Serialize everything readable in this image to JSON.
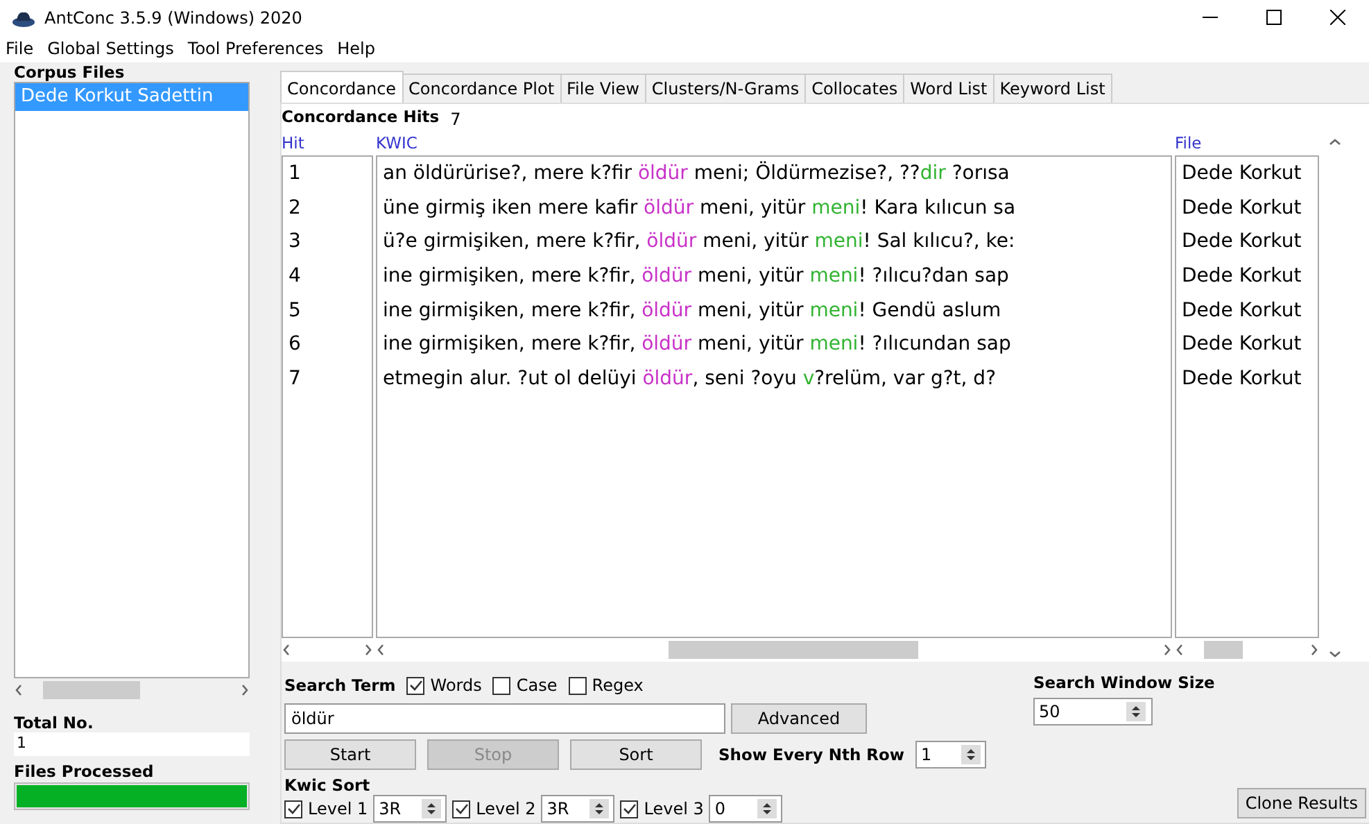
{
  "window": {
    "title": "AntConc 3.5.9 (Windows) 2020"
  },
  "menu": [
    "File",
    "Global Settings",
    "Tool Preferences",
    "Help"
  ],
  "corpus_files": {
    "title": "Corpus Files",
    "items": [
      {
        "label": "Dede Korkut Sadettin",
        "selected": true
      }
    ]
  },
  "total_no": {
    "label": "Total No.",
    "value": "1"
  },
  "files_processed": {
    "label": "Files Processed",
    "level": 1
  },
  "tabs": [
    {
      "label": "Concordance",
      "selected": true
    },
    {
      "label": "Concordance Plot",
      "selected": false
    },
    {
      "label": "File View",
      "selected": false
    },
    {
      "label": "Clusters/N-Grams",
      "selected": false
    },
    {
      "label": "Collocates",
      "selected": false
    },
    {
      "label": "Word List",
      "selected": false
    },
    {
      "label": "Keyword List",
      "selected": false
    }
  ],
  "hits": {
    "label": "Concordance Hits",
    "value": "7"
  },
  "table": {
    "columns": [
      "Hit",
      "KWIC",
      "File"
    ],
    "rows": [
      {
        "hit": "1",
        "kwic": [
          {
            "kind": "plain",
            "text": "an öldürürise?, mere k?fir "
          },
          {
            "kind": "node",
            "text": "öldür"
          },
          {
            "kind": "plain",
            "text": " meni; Öldürmezise?, ??"
          },
          {
            "kind": "collocate",
            "text": "dir"
          },
          {
            "kind": "plain",
            "text": " ?orısa"
          }
        ],
        "file": "Dede Korkut"
      },
      {
        "hit": "2",
        "kwic": [
          {
            "kind": "plain",
            "text": "üne girmiş iken mere kafir "
          },
          {
            "kind": "node",
            "text": "öldür"
          },
          {
            "kind": "plain",
            "text": " meni, yitür "
          },
          {
            "kind": "collocate",
            "text": "meni"
          },
          {
            "kind": "plain",
            "text": "! Kara kılıcun sa"
          }
        ],
        "file": "Dede Korkut"
      },
      {
        "hit": "3",
        "kwic": [
          {
            "kind": "plain",
            "text": "ü?e girmişiken, mere k?fir, "
          },
          {
            "kind": "node",
            "text": "öldür"
          },
          {
            "kind": "plain",
            "text": " meni, yitür "
          },
          {
            "kind": "collocate",
            "text": "meni"
          },
          {
            "kind": "plain",
            "text": "!  Sal kılıcu?, ke:"
          }
        ],
        "file": "Dede Korkut"
      },
      {
        "hit": "4",
        "kwic": [
          {
            "kind": "plain",
            "text": "ine girmişiken, mere k?fir, "
          },
          {
            "kind": "node",
            "text": "öldür"
          },
          {
            "kind": "plain",
            "text": " meni, yitür "
          },
          {
            "kind": "collocate",
            "text": "meni"
          },
          {
            "kind": "plain",
            "text": "! ?ılıcu?dan sap"
          }
        ],
        "file": "Dede Korkut"
      },
      {
        "hit": "5",
        "kwic": [
          {
            "kind": "plain",
            "text": "ine girmişiken, mere k?fir, "
          },
          {
            "kind": "node",
            "text": "öldür"
          },
          {
            "kind": "plain",
            "text": " meni, yitür "
          },
          {
            "kind": "collocate",
            "text": "meni"
          },
          {
            "kind": "plain",
            "text": "! Gendü aslum"
          }
        ],
        "file": "Dede Korkut"
      },
      {
        "hit": "6",
        "kwic": [
          {
            "kind": "plain",
            "text": "ine girmişiken, mere k?fir, "
          },
          {
            "kind": "node",
            "text": "öldür"
          },
          {
            "kind": "plain",
            "text": " meni, yitür "
          },
          {
            "kind": "collocate",
            "text": "meni"
          },
          {
            "kind": "plain",
            "text": "! ?ılıcundan sap"
          }
        ],
        "file": "Dede Korkut"
      },
      {
        "hit": "7",
        "kwic": [
          {
            "kind": "plain",
            "text": "etmegin alur. ?ut ol delüyi "
          },
          {
            "kind": "node",
            "text": "öldür"
          },
          {
            "kind": "plain",
            "text": ", seni ?oyu "
          },
          {
            "kind": "collocate",
            "text": "v"
          },
          {
            "kind": "plain",
            "text": "?relüm, var g?t, d?"
          }
        ],
        "file": "Dede Korkut"
      }
    ]
  },
  "search": {
    "label": "Search Term",
    "options": [
      {
        "label": "Words",
        "checked": true
      },
      {
        "label": "Case",
        "checked": false
      },
      {
        "label": "Regex",
        "checked": false
      }
    ],
    "value": "öldür",
    "advanced": "Advanced"
  },
  "window_size": {
    "label": "Search Window Size",
    "value": "50"
  },
  "buttons": [
    {
      "label": "Start",
      "disabled": false
    },
    {
      "label": "Stop",
      "disabled": true
    },
    {
      "label": "Sort",
      "disabled": false
    }
  ],
  "nth_row": {
    "label": "Show Every Nth Row",
    "value": "1"
  },
  "kwic_sort": {
    "label": "Kwic Sort",
    "levels": [
      {
        "label": "Level 1",
        "checked": true,
        "value": "3R"
      },
      {
        "label": "Level 2",
        "checked": true,
        "value": "3R"
      },
      {
        "label": "Level 3",
        "checked": true,
        "value": "0"
      }
    ]
  },
  "clone": "Clone Results"
}
